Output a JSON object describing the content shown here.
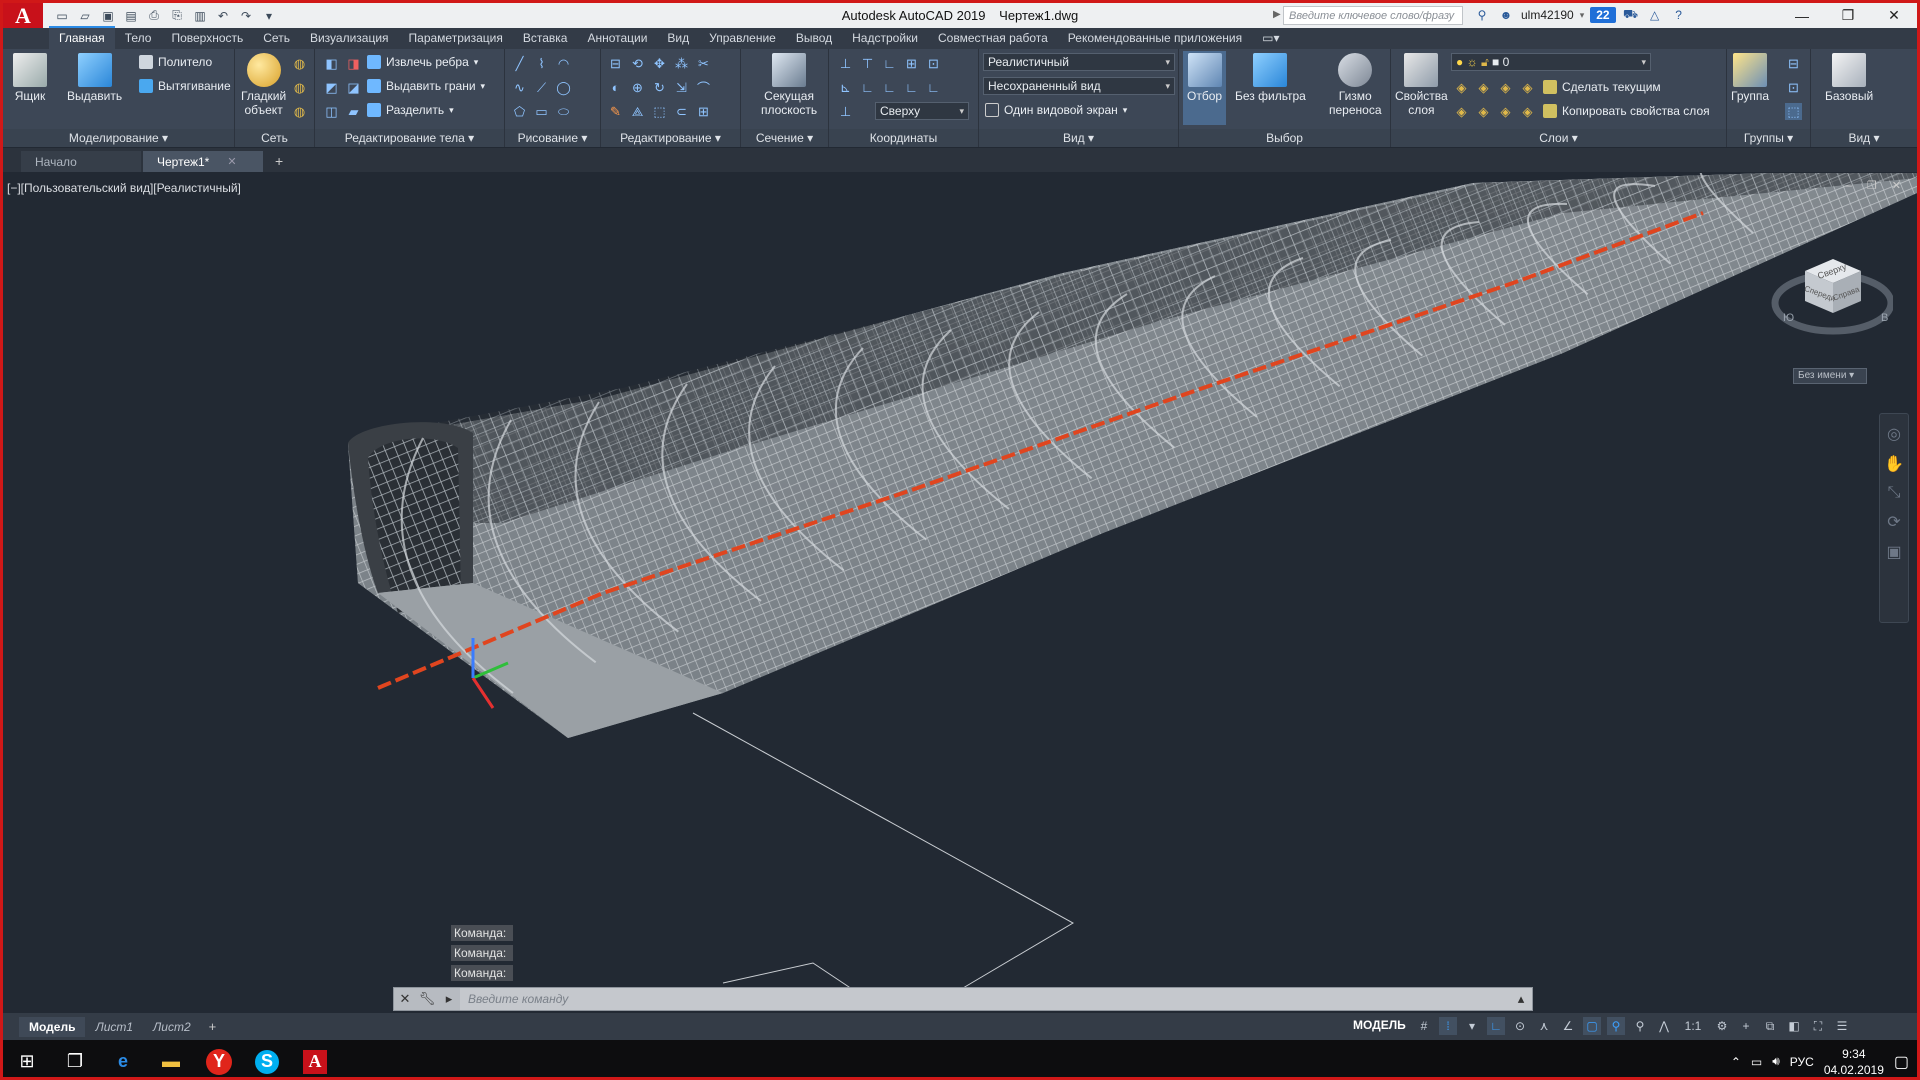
{
  "window": {
    "app_title": "Autodesk AutoCAD 2019",
    "file_title": "Чертеж1.dwg",
    "search_placeholder": "Введите ключевое слово/фразу",
    "user": "ulm42190",
    "notifications": "22"
  },
  "ribbon_tabs": [
    "Главная",
    "Тело",
    "Поверхность",
    "Сеть",
    "Визуализация",
    "Параметризация",
    "Вставка",
    "Аннотации",
    "Вид",
    "Управление",
    "Вывод",
    "Надстройки",
    "Совместная работа",
    "Рекомендованные приложения"
  ],
  "panels": {
    "modeling": {
      "title": "Моделирование ▾",
      "box": "Ящик",
      "extrude": "Выдавить",
      "polysolid": "Политело",
      "loft": "Вытягивание"
    },
    "mesh": {
      "title": "Сеть",
      "smooth_line1": "Гладкий",
      "smooth_line2": "объект"
    },
    "solid_edit": {
      "title": "Редактирование тела ▾",
      "extract_edges": "Извлечь ребра",
      "extrude_faces": "Выдавить грани",
      "separate": "Разделить"
    },
    "draw": {
      "title": "Рисование ▾"
    },
    "modify": {
      "title": "Редактирование ▾"
    },
    "section": {
      "title": "Сечение ▾",
      "plane_line1": "Секущая",
      "plane_line2": "плоскость"
    },
    "coords": {
      "title": "Координаты",
      "view_combo": "Сверху"
    },
    "view": {
      "title": "Вид ▾",
      "visual_style": "Реалистичный",
      "saved_view": "Несохраненный вид",
      "viewports": "Один видовой экран"
    },
    "selection": {
      "title": "Выбор",
      "culling": "Отбор",
      "no_filter": "Без фильтра",
      "gizmo_line1": "Гизмо",
      "gizmo_line2": "переноса"
    },
    "layers": {
      "title": "Слои ▾",
      "props_line1": "Свойства",
      "props_line2": "слоя",
      "layer_combo": "0",
      "make_current": "Сделать текущим",
      "match_layer": "Копировать свойства слоя"
    },
    "groups": {
      "title": "Группы ▾",
      "group": "Группа"
    },
    "view2": {
      "title": "Вид ▾",
      "base": "Базовый"
    }
  },
  "file_tabs": {
    "start": "Начало",
    "drawing": "Чертеж1*"
  },
  "viewport": {
    "label": "[−][Пользовательский вид][Реалистичный]",
    "viewcube_top": "Сверху",
    "viewcube_front": "Спереди",
    "viewcube_right": "Справа",
    "compass_s": "Ю",
    "compass_e": "В",
    "ucs_name": "Без имени"
  },
  "command": {
    "history": [
      "Команда:",
      "Команда:",
      "Команда:"
    ],
    "placeholder": "Введите команду"
  },
  "layout_tabs": [
    "Модель",
    "Лист1",
    "Лист2"
  ],
  "status": {
    "space": "МОДЕЛЬ",
    "scale": "1:1"
  },
  "taskbar": {
    "lang": "РУС",
    "time": "9:34",
    "date": "04.02.2019"
  },
  "colors": {
    "accent": "#2b8be6",
    "autocad_red": "#c8111a",
    "viewport_bg": "#222933",
    "ribbon_bg": "#3d4756",
    "rebar_orange": "#e0451f"
  }
}
